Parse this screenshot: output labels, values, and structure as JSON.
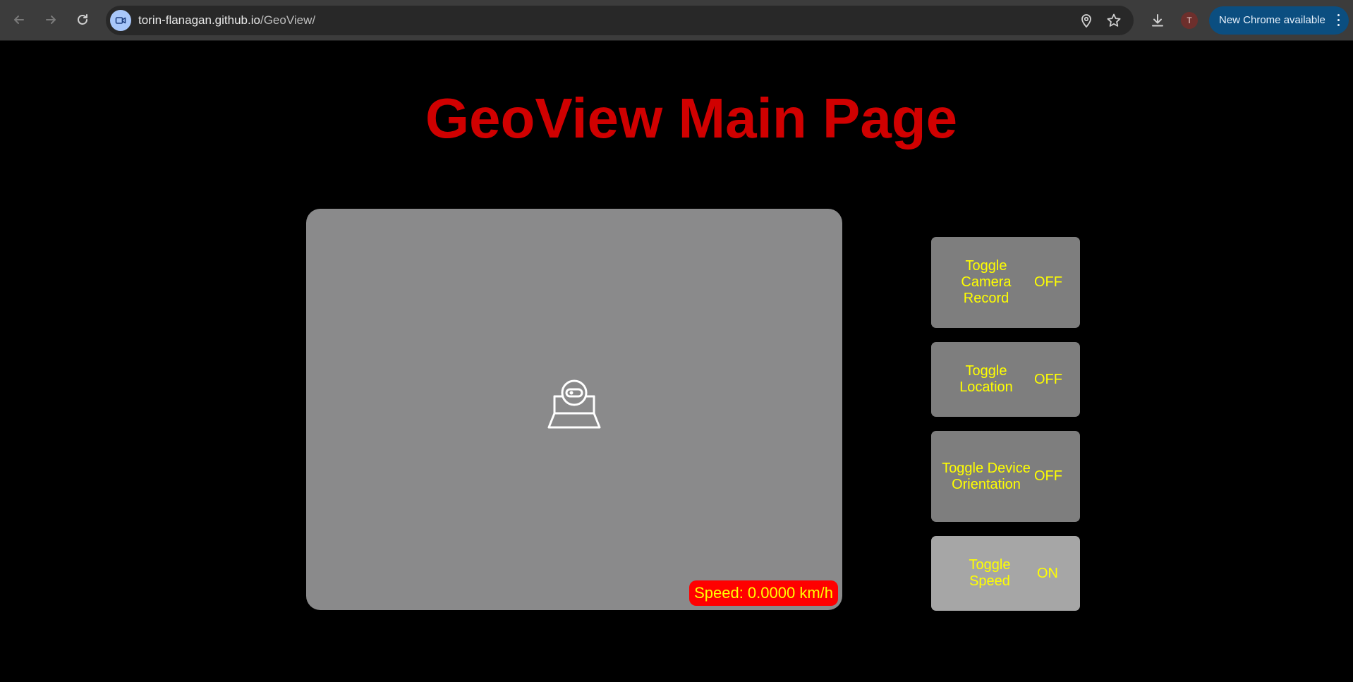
{
  "browser": {
    "url_host": "torin-flanagan.github.io",
    "url_path": "/GeoView/",
    "profile_initial": "T",
    "update_label": "New Chrome available"
  },
  "page": {
    "title": "GeoView Main Page",
    "speed_text": "Speed: 0.0000 km/h",
    "toggles": [
      {
        "label": "Toggle Camera Record",
        "state": "OFF"
      },
      {
        "label": "Toggle Location",
        "state": "OFF"
      },
      {
        "label": "Toggle Device Orientation",
        "state": "OFF"
      },
      {
        "label": "Toggle Speed",
        "state": "ON"
      }
    ]
  },
  "colors": {
    "title": "#d00000",
    "toggle_text": "#ffff00",
    "speed_badge_bg": "#ff0000",
    "toggle_off_bg": "#7e7e7e",
    "toggle_on_bg": "#a6a6a6",
    "viewer_bg": "#8a8a8b"
  },
  "icons": {
    "back": "arrow-left-icon",
    "forward": "arrow-right-icon",
    "reload": "reload-icon",
    "site": "video-camera-icon",
    "location": "location-pin-icon",
    "bookmark": "star-icon",
    "download": "download-icon",
    "menu": "kebab-menu-icon",
    "camera_placeholder": "webcam-icon"
  }
}
